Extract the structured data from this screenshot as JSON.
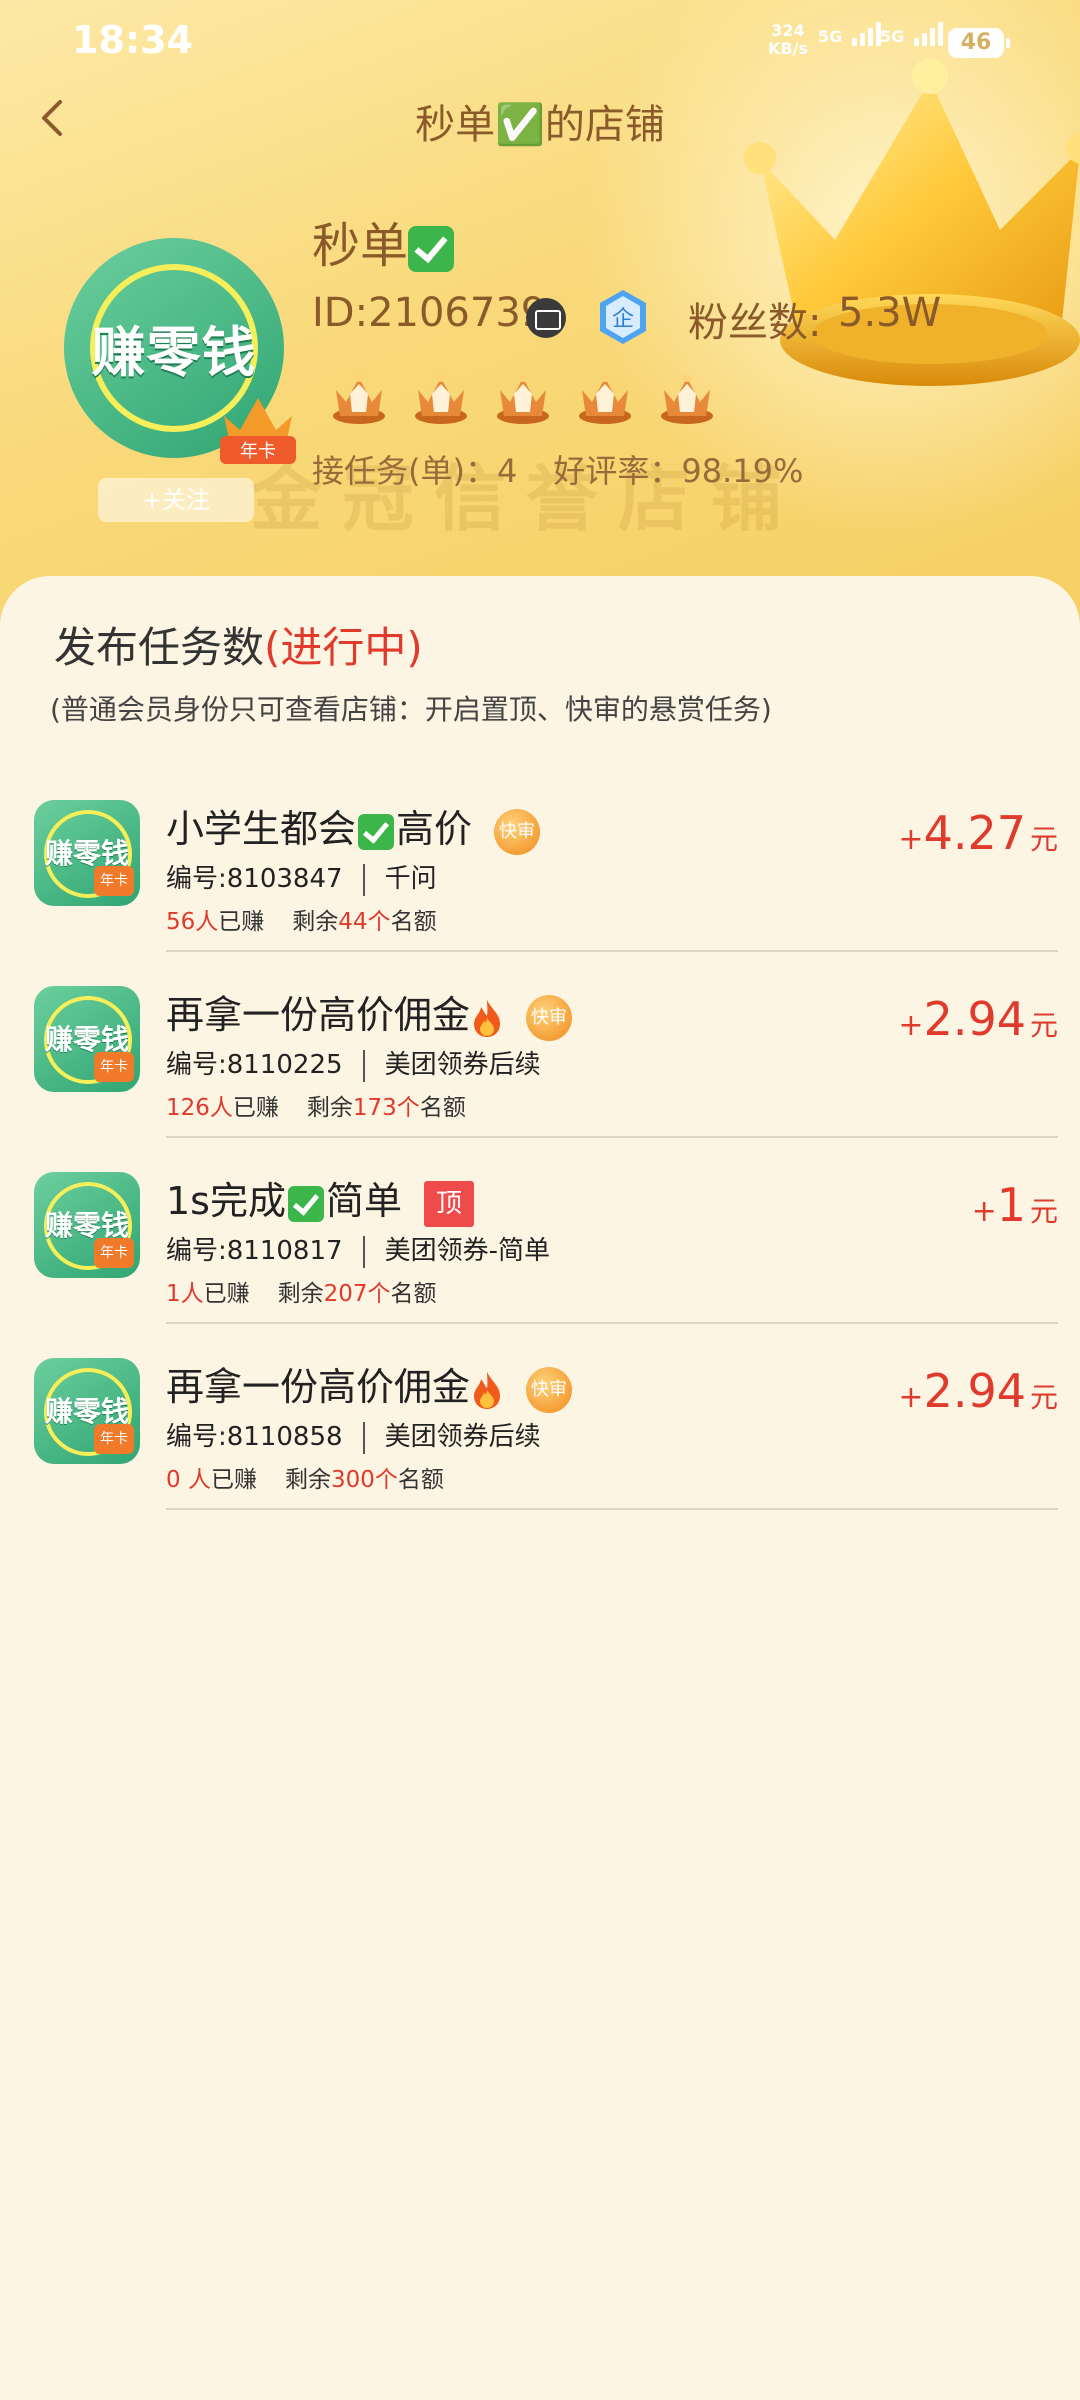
{
  "status_bar": {
    "time": "18:34",
    "net_speed_value": "324",
    "net_speed_unit": "KB/s",
    "signal1_label": "5G",
    "signal2_label": "5G",
    "battery": "46"
  },
  "header": {
    "title": "秒单✅的店铺",
    "shop_name": "秒单",
    "shop_id": "ID:2106739",
    "fans_label": "粉丝数:",
    "fans_value": "5.3W",
    "avatar_text": "赚零钱",
    "avatar_badge": "年卡",
    "follow_label": "+关注",
    "watermark": "金冠信誉店铺",
    "tasks_taken": "接任务(单)：4",
    "good_rate": "好评率：98.19%",
    "crown_count": 5
  },
  "section": {
    "title_main": "发布任务数",
    "title_status": "(进行中)",
    "note": "(普通会员身份只可查看店铺：开启置顶、快审的悬赏任务)"
  },
  "tasks": [
    {
      "icon_text": "赚零钱",
      "icon_badge": "年卡",
      "title_a": "小学生都会",
      "title_b": "高价",
      "badge": "快审",
      "number": "编号:8103847",
      "category": "千问",
      "earned_count": "56人",
      "earned_label": "已赚",
      "remain_label": "剩余",
      "remain_count": "44个",
      "quota_label": "名额",
      "price_plus": "+",
      "price": "4.27",
      "price_unit": "元"
    },
    {
      "icon_text": "赚零钱",
      "icon_badge": "年卡",
      "title_a": "再拿一份高价佣金",
      "badge": "快审",
      "number": "编号:8110225",
      "category": "美团领券后续",
      "earned_count": "126人",
      "earned_label": "已赚",
      "remain_label": "剩余",
      "remain_count": "173个",
      "quota_label": "名额",
      "price_plus": "+",
      "price": "2.94",
      "price_unit": "元"
    },
    {
      "icon_text": "赚零钱",
      "icon_badge": "年卡",
      "title_a": "1s完成",
      "title_b": "简单",
      "badge": "顶",
      "number": "编号:8110817",
      "category": "美团领券-简单",
      "earned_count": "1人",
      "earned_label": "已赚",
      "remain_label": "剩余",
      "remain_count": "207个",
      "quota_label": "名额",
      "price_plus": "+",
      "price": "1",
      "price_unit": "元"
    },
    {
      "icon_text": "赚零钱",
      "icon_badge": "年卡",
      "title_a": "再拿一份高价佣金",
      "badge": "快审",
      "number": "编号:8110858",
      "category": "美团领券后续",
      "earned_count": "0 人",
      "earned_label": "已赚",
      "remain_label": "剩余",
      "remain_count": "300个",
      "quota_label": "名额",
      "price_plus": "+",
      "price": "2.94",
      "price_unit": "元"
    }
  ],
  "colors": {
    "accent_red": "#e03a2c",
    "header_brown": "#8a5a2a",
    "header_gold": "#f9d97a",
    "page_bg": "#fdf5e3"
  }
}
